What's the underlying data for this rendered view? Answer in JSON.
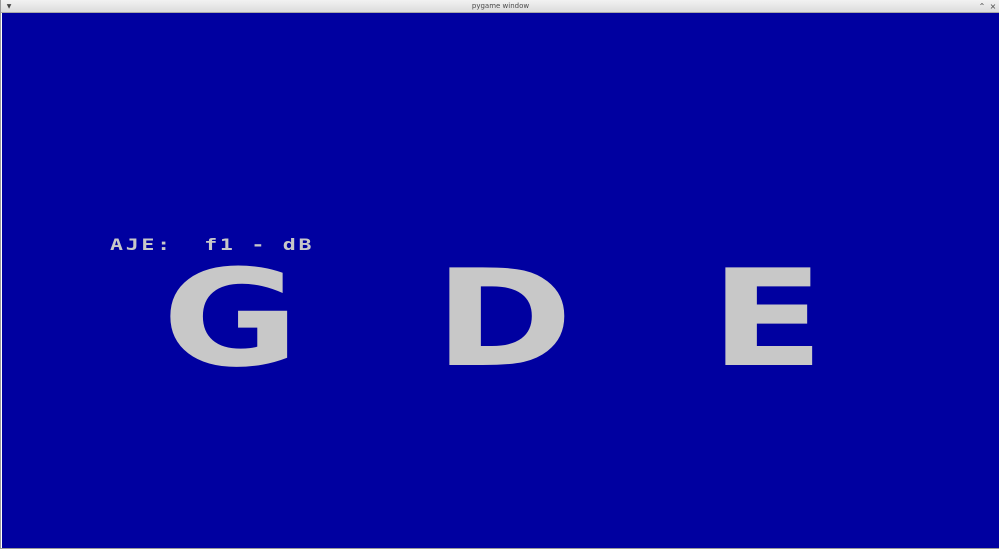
{
  "window": {
    "title": "pygame window"
  },
  "titlebar_icons": {
    "menu": "chevron-down-icon",
    "minimize": "minimize-icon",
    "close": "close-icon"
  },
  "colors": {
    "background": "#0000a0",
    "text": "#c8c8c8"
  },
  "game": {
    "prompt": "AJE:  f1 - dB",
    "letters": [
      "G",
      "D",
      "E"
    ]
  }
}
